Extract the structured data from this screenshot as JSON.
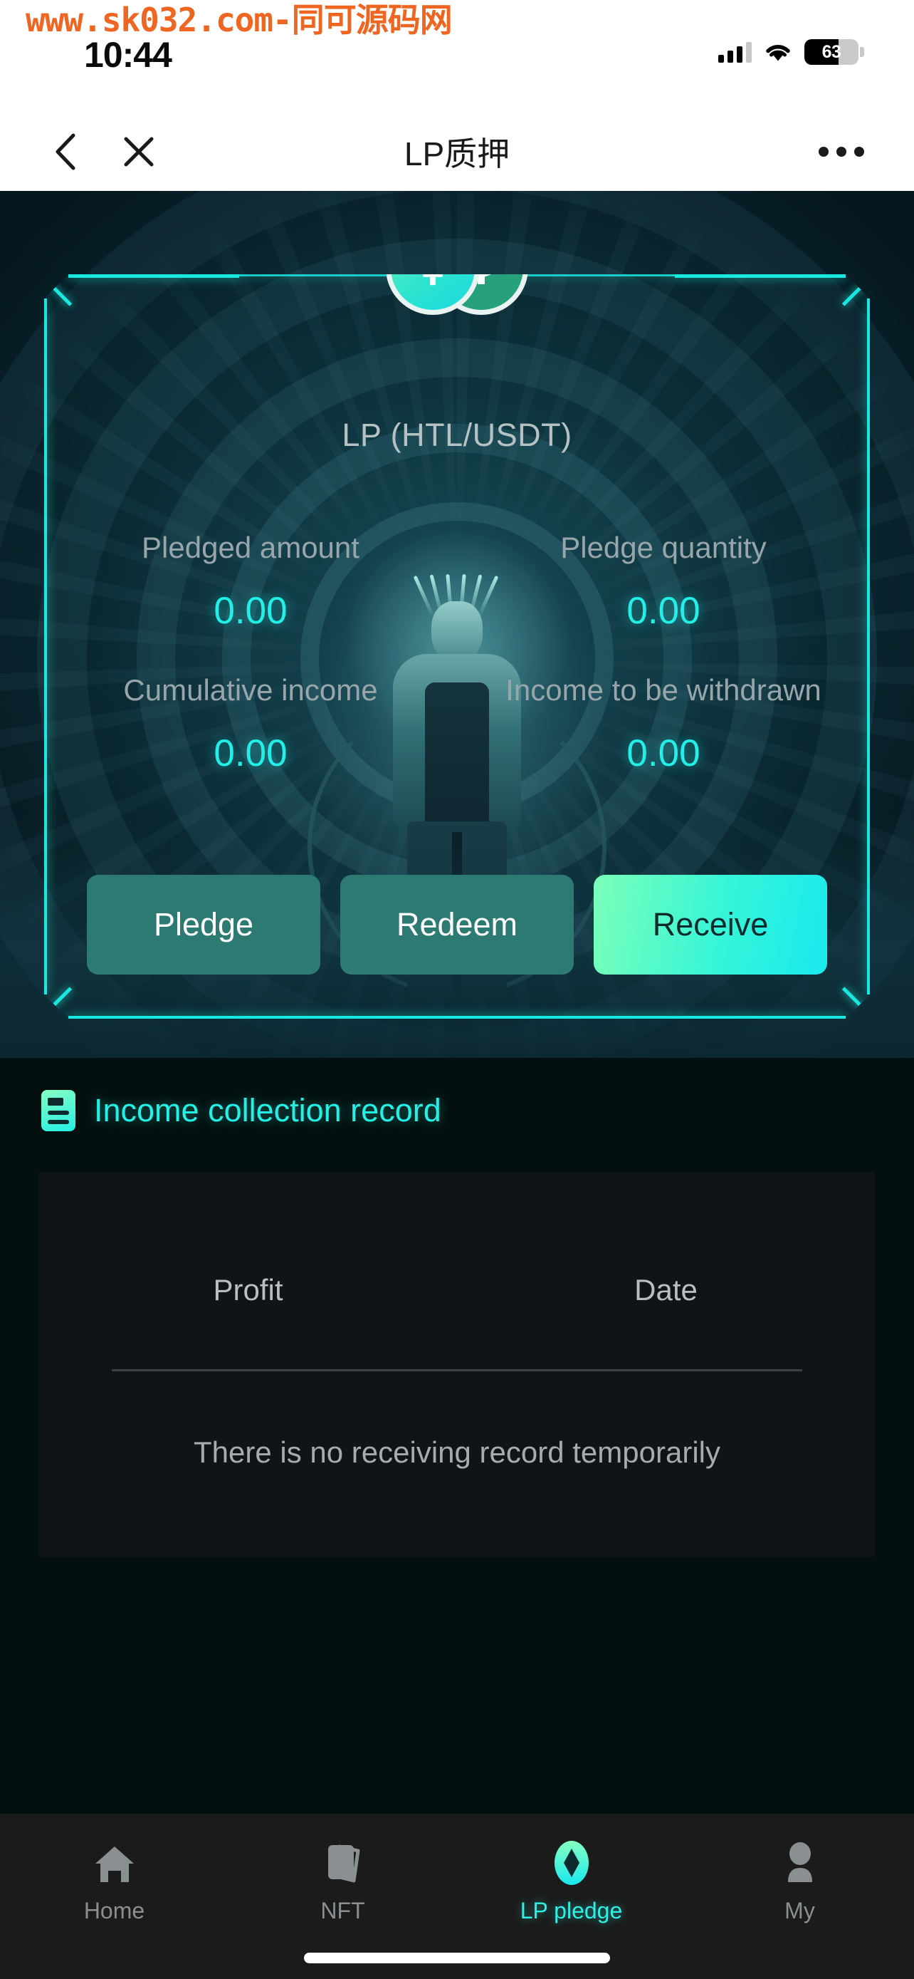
{
  "watermark": {
    "text": "www.sk032.com-同可源码网",
    "color": "#ee6622"
  },
  "status_bar": {
    "time": "10:44",
    "battery_percent": "63",
    "signal_icon": "cellular-signal-icon",
    "wifi_icon": "wifi-icon",
    "battery_icon": "battery-icon"
  },
  "nav": {
    "title": "LP质押",
    "back_icon": "chevron-left-icon",
    "close_icon": "close-icon",
    "more_icon": "more-options-icon"
  },
  "card": {
    "pair_title": "LP (HTL/USDT)",
    "coin_left_icon": "lp-token-icon",
    "coin_left_glyph": "⇞",
    "coin_right_icon": "usdt-token-icon",
    "coin_right_glyph": "₮",
    "accent_color": "#1ae8e0",
    "stats": [
      {
        "label": "Pledged amount",
        "value": "0.00"
      },
      {
        "label": "Pledge quantity",
        "value": "0.00"
      },
      {
        "label": "Cumulative income",
        "value": "0.00"
      },
      {
        "label": "Income to be withdrawn",
        "value": "0.00"
      }
    ],
    "buttons": [
      {
        "label": "Pledge",
        "style": "secondary"
      },
      {
        "label": "Redeem",
        "style": "secondary"
      },
      {
        "label": "Receive",
        "style": "primary"
      }
    ]
  },
  "record": {
    "heading": "Income collection record",
    "heading_icon": "record-list-icon",
    "columns": [
      "Profit",
      "Date"
    ],
    "empty_text": "There is no receiving record temporarily",
    "rows": []
  },
  "tabbar": {
    "items": [
      {
        "label": "Home",
        "icon": "home-icon",
        "active": false
      },
      {
        "label": "NFT",
        "icon": "nft-card-icon",
        "active": false
      },
      {
        "label": "LP pledge",
        "icon": "diamond-icon",
        "active": true
      },
      {
        "label": "My",
        "icon": "person-icon",
        "active": false
      }
    ],
    "active_color": "#2ef0e6",
    "inactive_color": "#8a9092"
  }
}
